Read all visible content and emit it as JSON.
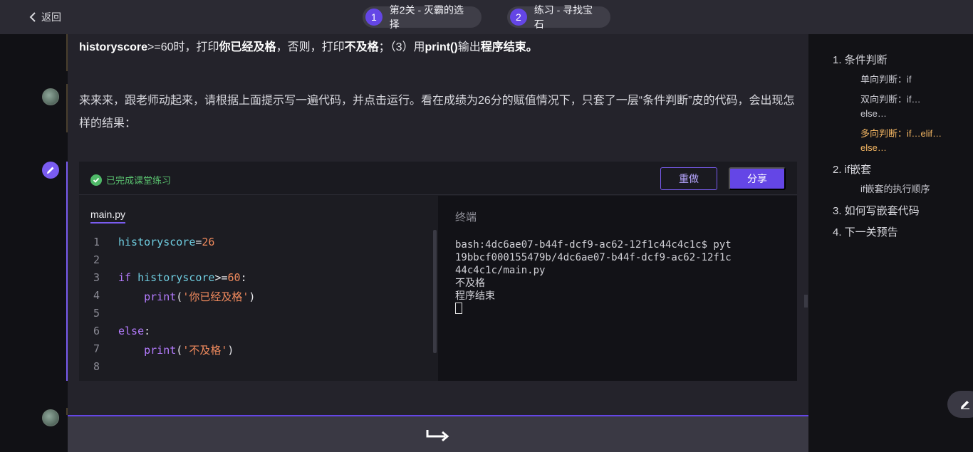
{
  "header": {
    "back_label": "返回",
    "steps": [
      {
        "number": "1",
        "label": "第2关 - 灭霸的选择"
      },
      {
        "number": "2",
        "label": "练习 - 寻找宝石"
      }
    ]
  },
  "messages": {
    "m1": {
      "p1": "historyscore",
      "p2": ">=60时，打印",
      "p3": "你已经及格",
      "p4": "，否则，打印",
      "p5": "不及格",
      "p6": "；（3）用",
      "p7": "print()",
      "p8": "输出",
      "p9": "程序结束。"
    },
    "m2": "来来来，跟老师动起来，请根据上面提示写一遍代码，并点击运行。看在成绩为26分的赋值情况下，只套了一层“条件判断”皮的代码，会出现怎样的结果："
  },
  "exercise": {
    "status": "已完成课堂练习",
    "redo_label": "重做",
    "share_label": "分享",
    "file_tab": "main.py",
    "line_numbers": [
      "1",
      "2",
      "3",
      "4",
      "5",
      "6",
      "7",
      "8"
    ],
    "code": {
      "l1_var": "historyscore",
      "l1_op": "=",
      "l1_num": "26",
      "l3_kw": "if",
      "l3_var": " historyscore",
      "l3_op": ">=",
      "l3_num": "60",
      "l3_colon": ":",
      "l4_indent": "    ",
      "l4_fn": "print",
      "l4_open": "(",
      "l4_str": "'你已经及格'",
      "l4_close": ")",
      "l6_kw": "else",
      "l6_colon": ":",
      "l7_indent": "    ",
      "l7_fn": "print",
      "l7_open": "(",
      "l7_str": "'不及格'",
      "l7_close": ")"
    },
    "terminal_title": "终端",
    "terminal_lines": [
      "bash:4dc6ae07-b44f-dcf9-ac62-12f1c44c4c1c$ pyt",
      "19bbcf000155479b/4dc6ae07-b44f-dcf9-ac62-12f1c",
      "44c4c1c/main.py",
      "不及格",
      "程序结束"
    ]
  },
  "toc": {
    "items": [
      {
        "label": "1. 条件判断"
      },
      {
        "label": "单向判断：if"
      },
      {
        "label": "双向判断：if…else…"
      },
      {
        "label": "多向判断：if…elif…else…"
      },
      {
        "label": "2. if嵌套"
      },
      {
        "label": "if嵌套的执行顺序"
      },
      {
        "label": "3. 如何写嵌套代码"
      },
      {
        "label": "4. 下一关预告"
      }
    ]
  },
  "colors": {
    "accent": "#6446e6",
    "success": "#4fb968",
    "active_toc": "#f5b763"
  }
}
